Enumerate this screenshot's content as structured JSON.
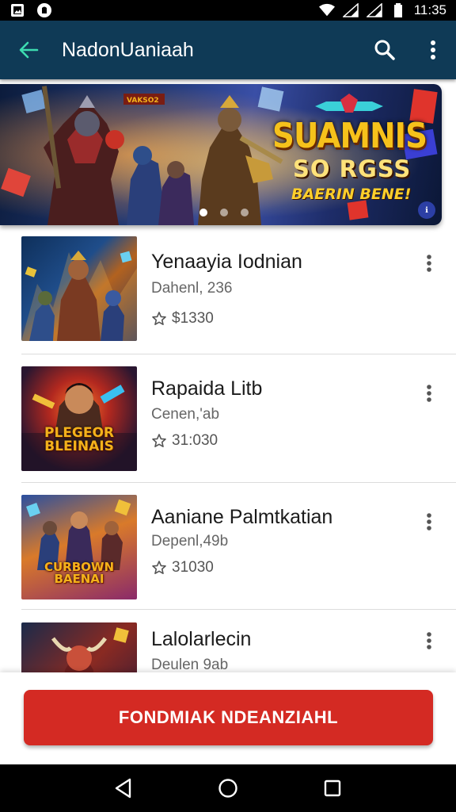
{
  "status_bar": {
    "time": "11:35",
    "icons": [
      "photo-icon",
      "notification-icon",
      "wifi-icon",
      "signal-icon",
      "battery-icon"
    ]
  },
  "app_bar": {
    "title": "NadonUaniaah",
    "back_icon": "back-arrow-icon",
    "search_icon": "search-icon",
    "menu_icon": "more-vert-icon"
  },
  "banner": {
    "title_line1": "SUAMNIS",
    "title_line2": "SO RGSS",
    "title_line3": "BAERIN BENE!",
    "badge": "ℹ",
    "slide_count": 3,
    "active_slide": 1
  },
  "games": [
    {
      "title": "Yenaayia Iodnian",
      "subtitle": "Dahenl, 236",
      "price": "$1330"
    },
    {
      "title": "Rapaida Litb",
      "subtitle": "Cenen,'ab",
      "price": "31:030",
      "thumb_text": "PLEGEOR BLEINAIS"
    },
    {
      "title": "Aaniane Palmtkatian",
      "subtitle": "Depenl,49b",
      "price": "31030",
      "thumb_text": "CURBOWN BAENAI"
    },
    {
      "title": "Lalolarlecin",
      "subtitle": "Deulen 9ab",
      "price": ""
    }
  ],
  "cta": {
    "label": "FONDMIAK NDEANZIAHL"
  },
  "colors": {
    "app_bar": "#0f3a56",
    "cta": "#d42a23",
    "back_arrow": "#3ddbb0"
  }
}
